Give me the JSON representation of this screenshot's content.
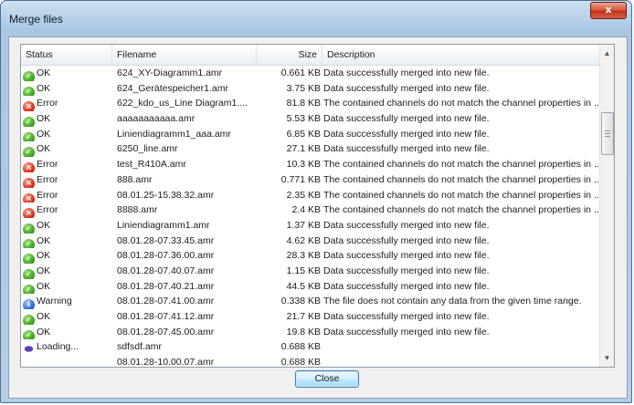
{
  "window": {
    "title": "Merge files",
    "close_glyph": "x"
  },
  "table": {
    "columns": {
      "status": "Status",
      "filename": "Filename",
      "size": "Size",
      "description": "Description"
    },
    "rows": [
      {
        "status": "OK",
        "icon": "ok-icon",
        "filename": "624_XY-Diagramm1.amr",
        "size": "0.661 KB",
        "description": "Data successfully merged into new file."
      },
      {
        "status": "OK",
        "icon": "ok-icon",
        "filename": "624_Gerätespeicher1.amr",
        "size": "3.75 KB",
        "description": "Data successfully merged into new file."
      },
      {
        "status": "Error",
        "icon": "error-icon",
        "filename": "622_kdo_us_Line Diagram1....",
        "size": "81.8 KB",
        "description": "The contained channels do not match the channel properties in ..."
      },
      {
        "status": "OK",
        "icon": "ok-icon",
        "filename": "aaaaaaaaaaa.amr",
        "size": "5.53 KB",
        "description": "Data successfully merged into new file."
      },
      {
        "status": "OK",
        "icon": "ok-icon",
        "filename": "Liniendiagramm1_aaa.amr",
        "size": "6.85 KB",
        "description": "Data successfully merged into new file."
      },
      {
        "status": "OK",
        "icon": "ok-icon",
        "filename": "6250_line.amr",
        "size": "27.1 KB",
        "description": "Data successfully merged into new file."
      },
      {
        "status": "Error",
        "icon": "error-icon",
        "filename": "test_R410A.amr",
        "size": "10.3 KB",
        "description": "The contained channels do not match the channel properties in ..."
      },
      {
        "status": "Error",
        "icon": "error-icon",
        "filename": "888.amr",
        "size": "0.771 KB",
        "description": "The contained channels do not match the channel properties in ..."
      },
      {
        "status": "Error",
        "icon": "error-icon",
        "filename": "08.01.25-15.38.32.amr",
        "size": "2.35 KB",
        "description": "The contained channels do not match the channel properties in ..."
      },
      {
        "status": "Error",
        "icon": "error-icon",
        "filename": "8888.amr",
        "size": "2.4 KB",
        "description": "The contained channels do not match the channel properties in ..."
      },
      {
        "status": "OK",
        "icon": "ok-icon",
        "filename": "Liniendiagramm1.amr",
        "size": "1.37 KB",
        "description": "Data successfully merged into new file."
      },
      {
        "status": "OK",
        "icon": "ok-icon",
        "filename": "08.01.28-07.33.45.amr",
        "size": "4.62 KB",
        "description": "Data successfully merged into new file."
      },
      {
        "status": "OK",
        "icon": "ok-icon",
        "filename": "08.01.28-07.36.00.amr",
        "size": "28.3 KB",
        "description": "Data successfully merged into new file."
      },
      {
        "status": "OK",
        "icon": "ok-icon",
        "filename": "08.01.28-07.40.07.amr",
        "size": "1.15 KB",
        "description": "Data successfully merged into new file."
      },
      {
        "status": "OK",
        "icon": "ok-icon",
        "filename": "08.01.28-07.40.21.amr",
        "size": "44.5 KB",
        "description": "Data successfully merged into new file."
      },
      {
        "status": "Warning",
        "icon": "warning-icon",
        "filename": "08.01.28-07.41.00.amr",
        "size": "0.338 KB",
        "description": "The file does not contain any data from the given time range."
      },
      {
        "status": "OK",
        "icon": "ok-icon",
        "filename": "08.01.28-07.41.12.amr",
        "size": "21.7 KB",
        "description": "Data successfully merged into new file."
      },
      {
        "status": "OK",
        "icon": "ok-icon",
        "filename": "08.01.28-07.45.00.amr",
        "size": "19.8 KB",
        "description": "Data successfully merged into new file."
      },
      {
        "status": "Loading...",
        "icon": "loading-icon",
        "filename": "sdfsdf.amr",
        "size": "0.688 KB",
        "description": ""
      },
      {
        "status": "",
        "icon": "",
        "filename": "08.01.28-10.00.07.amr",
        "size": "0.688 KB",
        "description": ""
      }
    ]
  },
  "buttons": {
    "close": "Close"
  }
}
